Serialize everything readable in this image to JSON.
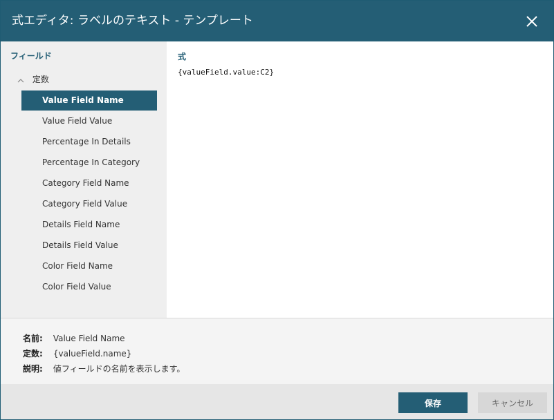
{
  "dialog": {
    "title": "式エディタ: ラベルのテキスト - テンプレート",
    "close_icon": "close-icon"
  },
  "sidebar": {
    "section_title": "フィールド",
    "group_label": "定数",
    "items": [
      {
        "label": "Value Field Name"
      },
      {
        "label": "Value Field Value"
      },
      {
        "label": "Percentage In Details"
      },
      {
        "label": "Percentage In Category"
      },
      {
        "label": "Category Field Name"
      },
      {
        "label": "Category Field Value"
      },
      {
        "label": "Details Field Name"
      },
      {
        "label": "Details Field Value"
      },
      {
        "label": "Color Field Name"
      },
      {
        "label": "Color Field Value"
      }
    ]
  },
  "main": {
    "label": "式",
    "expression": "{valueField.value:C2}"
  },
  "info": {
    "name_key": "名前:",
    "name_value": "Value Field Name",
    "constant_key": "定数:",
    "constant_value": "{valueField.name}",
    "description_key": "説明:",
    "description_value": "値フィールドの名前を表示します。"
  },
  "footer": {
    "save_label": "保存",
    "cancel_label": "キャンセル"
  },
  "colors": {
    "accent": "#245e75",
    "sidebar_bg": "#efefef",
    "footer_bg": "#e6e6e6"
  }
}
